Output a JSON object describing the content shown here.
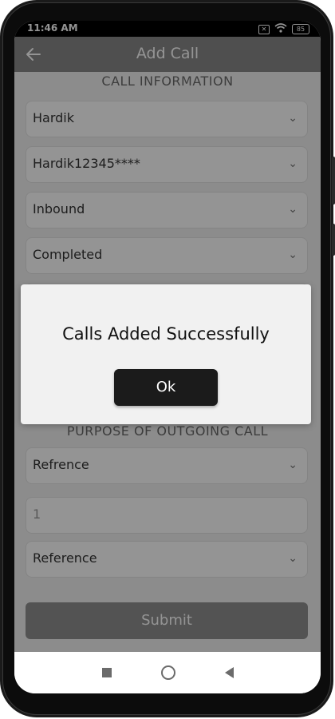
{
  "status_bar": {
    "time": "11:46 AM",
    "battery": "85"
  },
  "app_bar": {
    "title": "Add Call"
  },
  "sections": {
    "call_information": "CALL INFORMATION",
    "purpose_outgoing": "PURPOSE OF OUTGOING CALL"
  },
  "fields": [
    {
      "value": "Hardik"
    },
    {
      "value": "Hardik12345****"
    },
    {
      "value": "Inbound"
    },
    {
      "value": "Completed"
    },
    {
      "value": "Refrence"
    },
    {
      "value": "1"
    },
    {
      "value": "Reference"
    }
  ],
  "obscured_fields": [
    {
      "value": ""
    },
    {
      "value": ""
    }
  ],
  "submit_label": "Submit",
  "dialog": {
    "message": "Calls Added Successfully",
    "ok_label": "Ok"
  }
}
